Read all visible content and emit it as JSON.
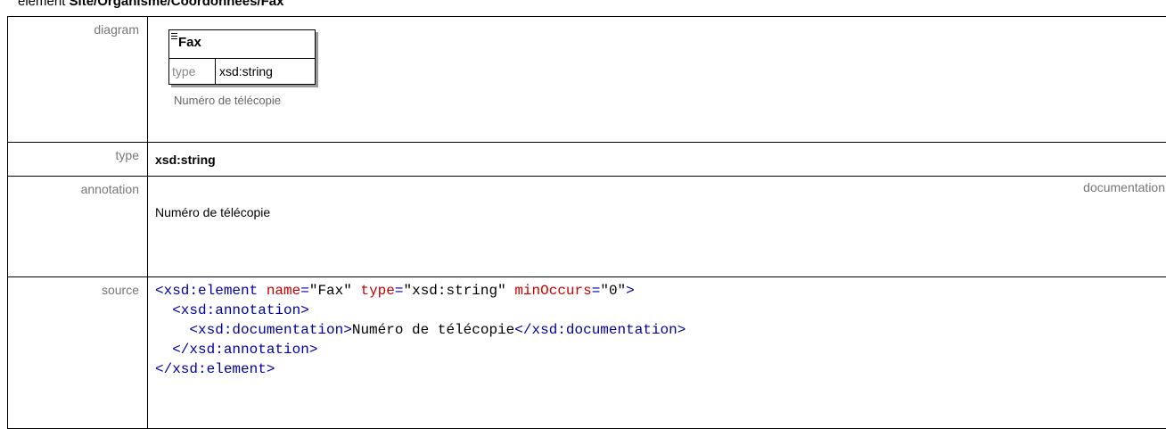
{
  "heading": {
    "prefix": "element ",
    "path": "Site/Organisme/Coordonnees/Fax"
  },
  "rows": {
    "diagram_label": "diagram",
    "type_label": "type",
    "annotation_label": "annotation",
    "source_label": "source"
  },
  "diagram": {
    "element_name": "Fax",
    "type_key": "type",
    "type_value": "xsd:string",
    "caption": "Numéro de télécopie"
  },
  "type_value": "xsd:string",
  "annotation": {
    "tag": "documentation",
    "text": "Numéro de télécopie"
  },
  "source": {
    "line1": {
      "open": "<xsd:element",
      "attr1": "name",
      "val1": "\"Fax\"",
      "attr2": "type",
      "val2": "\"xsd:string\"",
      "attr3": "minOccurs",
      "val3": "\"0\"",
      "close": ">"
    },
    "line2": "<xsd:annotation>",
    "line3_open": "<xsd:documentation>",
    "line3_text": "Numéro de télécopie",
    "line3_close": "</xsd:documentation>",
    "line4": "</xsd:annotation>",
    "line5": "</xsd:element>"
  }
}
